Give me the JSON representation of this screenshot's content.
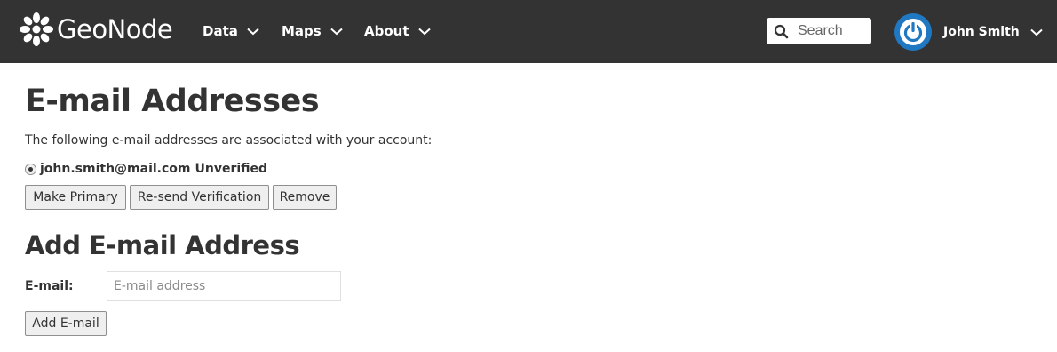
{
  "navbar": {
    "brand": "GeoNode",
    "menu": [
      {
        "label": "Data"
      },
      {
        "label": "Maps"
      },
      {
        "label": "About"
      }
    ],
    "search_placeholder": "Search",
    "user_name": "John Smith"
  },
  "page": {
    "title": "E-mail Addresses",
    "description": "The following e-mail addresses are associated with your account:",
    "emails": [
      {
        "address": "john.smith@mail.com",
        "status": "Unverified",
        "selected": true
      }
    ],
    "actions": {
      "make_primary": "Make Primary",
      "resend": "Re-send Verification",
      "remove": "Remove"
    },
    "add_section": {
      "title": "Add E-mail Address",
      "field_label": "E-mail:",
      "field_placeholder": "E-mail address",
      "field_value": "",
      "submit_label": "Add E-mail"
    }
  },
  "colors": {
    "navbar_bg": "#333333",
    "avatar_blue": "#1f78c1",
    "text": "#333333"
  }
}
